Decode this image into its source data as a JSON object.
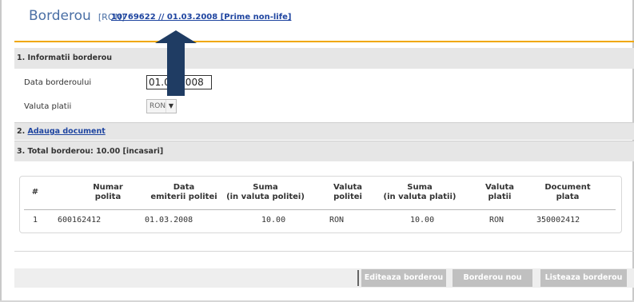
{
  "header": {
    "title": "Borderou",
    "currency": "[RON]",
    "ref_link": "10769622 // 01.03.2008 [Prime non-life]"
  },
  "sections": {
    "info_title": "1. Informatii borderou",
    "add_prefix": "2. ",
    "add_link": "Adauga document",
    "total_title": "3. Total borderou: 10.00 [incasari]"
  },
  "form": {
    "date_label": "Data borderoului",
    "date_value": "01.03.2008",
    "currency_label": "Valuta platii",
    "currency_value": "RON"
  },
  "table": {
    "headers": [
      {
        "l1": "#",
        "l2": ""
      },
      {
        "l1": "Numar",
        "l2": "polita"
      },
      {
        "l1": "Data",
        "l2": "emiterii politei"
      },
      {
        "l1": "Suma",
        "l2": "(in valuta politei)"
      },
      {
        "l1": "Valuta",
        "l2": "politei"
      },
      {
        "l1": "Suma",
        "l2": "(in valuta platii)"
      },
      {
        "l1": "Valuta",
        "l2": "platii"
      },
      {
        "l1": "Document",
        "l2": "plata"
      }
    ],
    "rows": [
      [
        "1",
        "600162412",
        "01.03.2008",
        "10.00",
        "RON",
        "10.00",
        "RON",
        "350002412"
      ]
    ]
  },
  "buttons": {
    "edit": "Editeaza borderou",
    "new": "Borderou nou",
    "list": "Listeaza borderou"
  },
  "colors": {
    "accent": "#f0a800",
    "link": "#1f45a0",
    "arrow": "#1f3c63",
    "button": "#c0c0c0"
  },
  "icons": {
    "annotation": "up-arrow-icon",
    "dropdown": "chevron-down-icon"
  }
}
